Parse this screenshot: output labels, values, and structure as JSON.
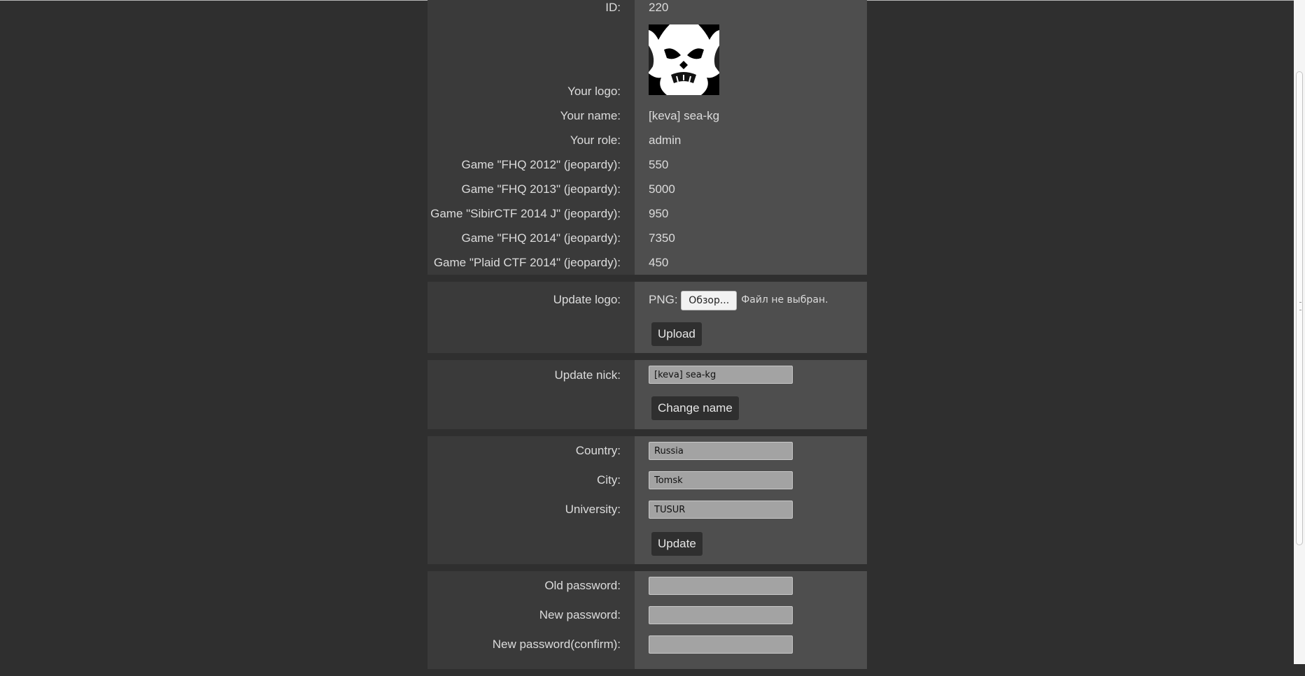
{
  "profile": {
    "id_label": "ID:",
    "id_value": "220",
    "logo_label": "Your logo:",
    "name_label": "Your name:",
    "name_value": "[keva] sea-kg",
    "role_label": "Your role:",
    "role_value": "admin",
    "games": [
      {
        "label": "Game \"FHQ 2012\" (jeopardy):",
        "score": "550"
      },
      {
        "label": "Game \"FHQ 2013\" (jeopardy):",
        "score": "5000"
      },
      {
        "label": "Game \"SibirCTF 2014 J\" (jeopardy):",
        "score": "950"
      },
      {
        "label": "Game \"FHQ 2014\" (jeopardy):",
        "score": "7350"
      },
      {
        "label": "Game \"Plaid CTF 2014\" (jeopardy):",
        "score": "450"
      }
    ]
  },
  "update_logo": {
    "label": "Update logo:",
    "format_label": "PNG:",
    "browse_button": "Обзор...",
    "file_status": "Файл не выбран.",
    "upload_button": "Upload"
  },
  "update_nick": {
    "label": "Update nick:",
    "value": "[keva] sea-kg",
    "button": "Change name"
  },
  "location": {
    "country_label": "Country:",
    "country_value": "Russia",
    "city_label": "City:",
    "city_value": "Tomsk",
    "university_label": "University:",
    "university_value": "TUSUR",
    "button": "Update"
  },
  "password": {
    "old_label": "Old password:",
    "new_label": "New password:",
    "confirm_label": "New password(confirm):"
  },
  "colors": {
    "background": "#2f2f2f",
    "label_column": "#3a3a3a",
    "value_column": "#4e4e4e",
    "input_background": "#a3a3a3"
  }
}
